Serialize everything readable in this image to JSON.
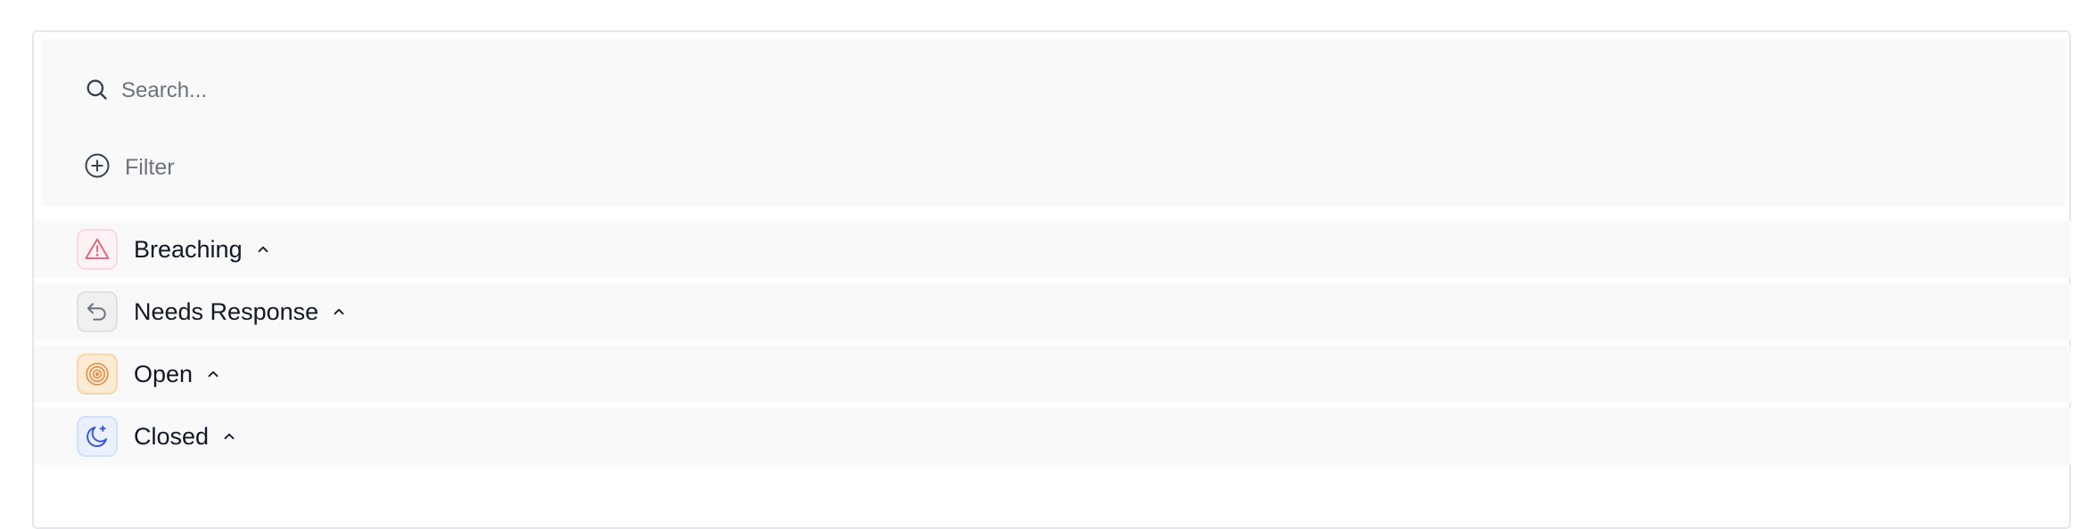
{
  "search": {
    "placeholder": "Search...",
    "value": ""
  },
  "filter": {
    "label": "Filter"
  },
  "groups": [
    {
      "label": "Breaching",
      "icon": "alert-triangle-icon",
      "color": "#e8607a"
    },
    {
      "label": "Needs Response",
      "icon": "reply-arrow-icon",
      "color": "#6b7280"
    },
    {
      "label": "Open",
      "icon": "target-icon",
      "color": "#e0904a"
    },
    {
      "label": "Closed",
      "icon": "moon-star-icon",
      "color": "#3b5bdb"
    }
  ]
}
